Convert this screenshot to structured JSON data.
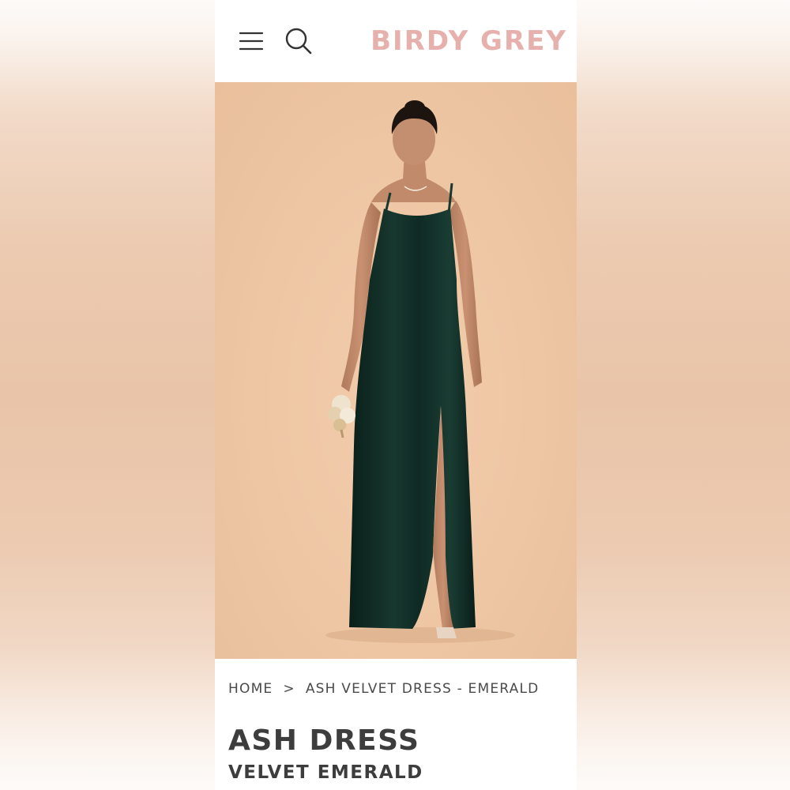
{
  "header": {
    "brand": "BIRDY GREY",
    "menu_icon": "hamburger-menu-icon",
    "search_icon": "search-icon",
    "brand_color": "#e6b0ad"
  },
  "hero": {
    "background_color": "#eec6a4",
    "dress_color": "#0f2a24"
  },
  "breadcrumb": {
    "home": "HOME",
    "separator": ">",
    "current": "ASH VELVET DRESS - EMERALD"
  },
  "product": {
    "title": "ASH DRESS",
    "subtitle": "VELVET EMERALD"
  }
}
